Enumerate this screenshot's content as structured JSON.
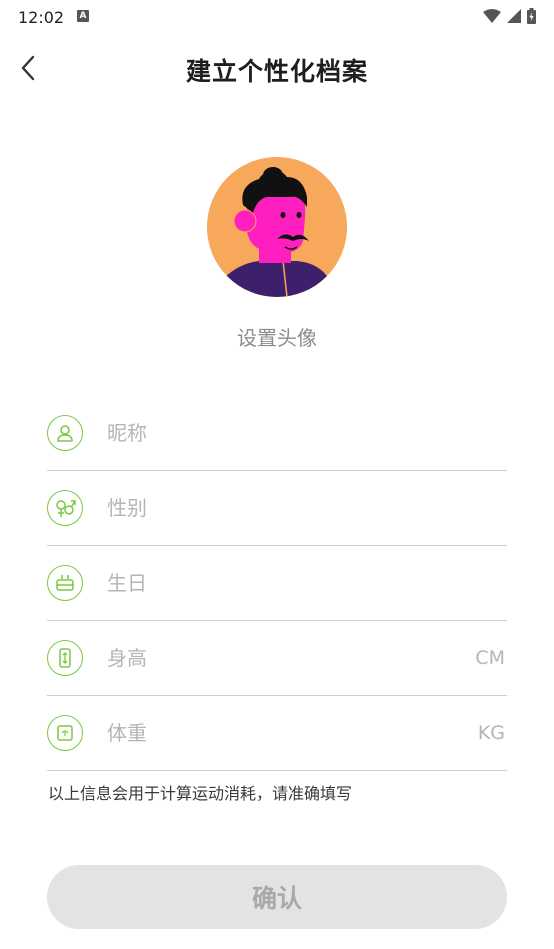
{
  "status_bar": {
    "time": "12:02",
    "notif_letter": "A"
  },
  "header": {
    "title": "建立个性化档案"
  },
  "avatar": {
    "caption": "设置头像"
  },
  "form": {
    "nickname": {
      "placeholder": "昵称"
    },
    "gender": {
      "placeholder": "性别"
    },
    "birthday": {
      "placeholder": "生日"
    },
    "height": {
      "placeholder": "身高",
      "unit": "CM"
    },
    "weight": {
      "placeholder": "体重",
      "unit": "KG"
    }
  },
  "hint": "以上信息会用于计算运动消耗，请准确填写",
  "confirm_label": "确认",
  "colors": {
    "accent": "#7ac943",
    "avatar_bg": "#f7a85a",
    "button_bg": "#e3e3e3"
  }
}
